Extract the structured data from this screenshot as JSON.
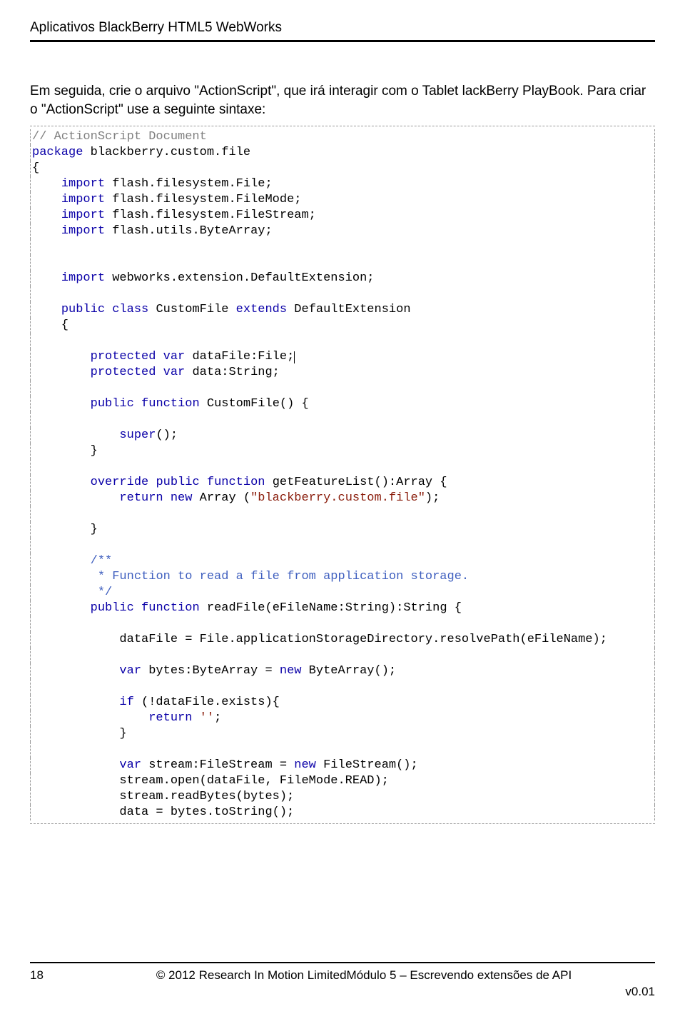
{
  "header": {
    "title": "Aplicativos BlackBerry HTML5 WebWorks"
  },
  "intro": "Em seguida, crie o arquivo \"ActionScript\", que irá interagir com o Tablet lackBerry PlayBook. Para criar o \"ActionScript\" use a seguinte sintaxe:",
  "code": {
    "l00a": "// ActionScript Document",
    "l00k": "package",
    "l00b": " blackberry.custom.file",
    "l01": "{",
    "l02a": "    ",
    "l02k": "import",
    "l02b": " flash.filesystem.File;",
    "l03a": "    ",
    "l03k": "import",
    "l03b": " flash.filesystem.FileMode;",
    "l04a": "    ",
    "l04k": "import",
    "l04b": " flash.filesystem.FileStream;",
    "l05a": "    ",
    "l05k": "import",
    "l05b": " flash.utils.ByteArray;",
    "l06": "",
    "l07": "",
    "l08a": "    ",
    "l08k": "import",
    "l08b": " webworks.extension.DefaultExtension;",
    "l09": "",
    "l10a": "    ",
    "l10k1": "public",
    "l10s1": " ",
    "l10k2": "class",
    "l10b": " CustomFile ",
    "l10k3": "extends",
    "l10c": " DefaultExtension",
    "l11": "    {",
    "l12": "",
    "l13a": "        ",
    "l13k1": "protected",
    "l13s1": " ",
    "l13k2": "var",
    "l13b": " dataFile:File;",
    "l14a": "        ",
    "l14k1": "protected",
    "l14s1": " ",
    "l14k2": "var",
    "l14b": " data:String;",
    "l15": "",
    "l16a": "        ",
    "l16k1": "public",
    "l16s1": " ",
    "l16k2": "function",
    "l16b": " CustomFile() {",
    "l17": "",
    "l18a": "            ",
    "l18k": "super",
    "l18b": "();",
    "l19": "        }",
    "l20": "",
    "l21a": "        ",
    "l21k1": "override",
    "l21s1": " ",
    "l21k2": "public",
    "l21s2": " ",
    "l21k3": "function",
    "l21b": " getFeatureList():Array {",
    "l22a": "            ",
    "l22k1": "return",
    "l22s1": " ",
    "l22k2": "new",
    "l22b": " Array (",
    "l22str": "\"blackberry.custom.file\"",
    "l22c": ");",
    "l23": "",
    "l24": "        }",
    "l25": "",
    "l26a": "        ",
    "l26d": "/**",
    "l27a": "         ",
    "l27d": "* Function to read a file from application storage.",
    "l28a": "         ",
    "l28d": "*/",
    "l29a": "        ",
    "l29k1": "public",
    "l29s1": " ",
    "l29k2": "function",
    "l29b": " readFile(eFileName:String):String {",
    "l30": "",
    "l31": "            dataFile = File.applicationStorageDirectory.resolvePath(eFileName);",
    "l32": "",
    "l33a": "            ",
    "l33k": "var",
    "l33b": " bytes:ByteArray = ",
    "l33k2": "new",
    "l33c": " ByteArray();",
    "l34": "",
    "l35a": "            ",
    "l35k": "if",
    "l35b": " (!dataFile.exists){",
    "l36a": "                ",
    "l36k": "return",
    "l36b": " ",
    "l36str": "''",
    "l36c": ";",
    "l37": "            }",
    "l38": "",
    "l39a": "            ",
    "l39k": "var",
    "l39b": " stream:FileStream = ",
    "l39k2": "new",
    "l39c": " FileStream();",
    "l40": "            stream.open(dataFile, FileMode.READ);",
    "l41": "            stream.readBytes(bytes);",
    "l42": "            data = bytes.toString();"
  },
  "footer": {
    "page": "18",
    "center": "© 2012 Research In Motion LimitedMódulo 5 – Escrevendo extensões de API",
    "right": "v0.01"
  }
}
